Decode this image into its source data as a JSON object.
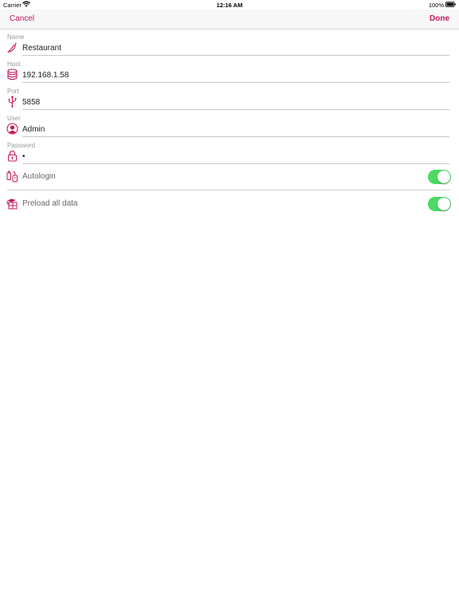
{
  "status_bar": {
    "carrier": "Carrier",
    "time": "12:16 AM",
    "battery": "100%"
  },
  "nav": {
    "cancel_label": "Cancel",
    "done_label": "Done"
  },
  "form": {
    "name": {
      "label": "Name",
      "value": "Restaurant",
      "icon": "chili-pepper-icon"
    },
    "host": {
      "label": "Host",
      "value": "192.168.1.58",
      "icon": "database-icon"
    },
    "port": {
      "label": "Port",
      "value": "5858",
      "icon": "usb-icon"
    },
    "user": {
      "label": "User",
      "value": "Admin",
      "icon": "user-icon"
    },
    "password": {
      "label": "Password",
      "value": "•",
      "icon": "lock-icon"
    }
  },
  "toggles": {
    "autologin": {
      "label": "Autologin",
      "on": true,
      "icon": "autologin-icon"
    },
    "preload": {
      "label": "Preload all data",
      "on": true,
      "icon": "preload-icon"
    }
  },
  "colors": {
    "accent": "#c2185b",
    "switch_on": "#4cd964"
  }
}
